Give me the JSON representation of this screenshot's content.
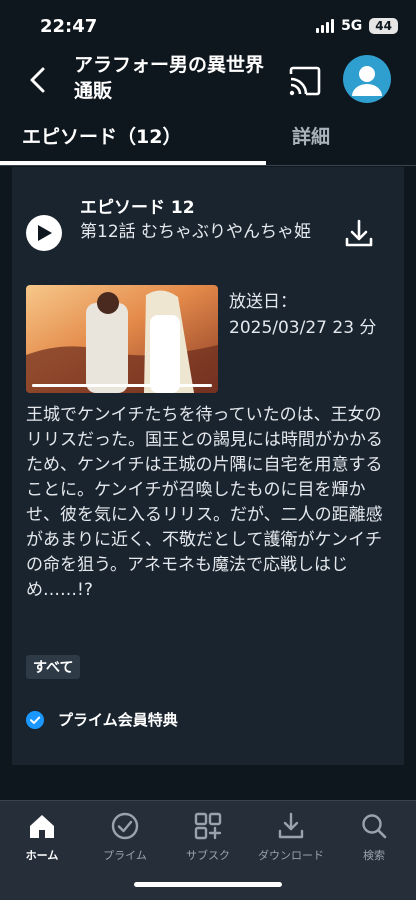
{
  "status": {
    "time": "22:47",
    "network": "5G",
    "battery": "44"
  },
  "header": {
    "title": "アラフォー男の異世界通販"
  },
  "tabs": [
    {
      "label": "エピソード（12）"
    },
    {
      "label": "詳細"
    }
  ],
  "episode": {
    "title": "エピソード 12",
    "subtitle": "第12話 むちゃぶりやんちゃ姫",
    "air_label": "放送日：",
    "air_value": "2025/03/27 23 分",
    "progress": 1.0,
    "synopsis": "王城でケンイチたちを待っていたのは、王女のリリスだった。国王との謁見には時間がかかるため、ケンイチは王城の片隅に自宅を用意することに。ケンイチが召喚したものに目を輝かせ、彼を気に入るリリス。だが、二人の距離感があまりに近く、不敬だとして護衛がケンイチの命を狙う。アネモネも魔法で応戦しはじめ……!?",
    "tag": "すべて",
    "prime_label": "プライム会員特典"
  },
  "nav": [
    {
      "label": "ホーム",
      "icon": "home-icon"
    },
    {
      "label": "プライム",
      "icon": "check-circle-icon"
    },
    {
      "label": "サブスク",
      "icon": "grid-plus-icon"
    },
    {
      "label": "ダウンロード",
      "icon": "download-icon"
    },
    {
      "label": "検索",
      "icon": "search-icon"
    }
  ],
  "colors": {
    "background": "#0f171e",
    "card": "#1a242f",
    "accent": "#1a98ff",
    "nav": "#252e39"
  }
}
